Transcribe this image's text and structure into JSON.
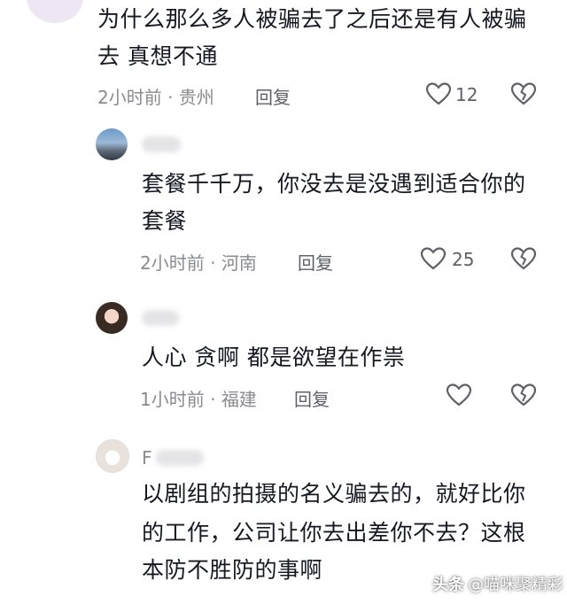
{
  "comments": [
    {
      "text_lines": [
        "为什么那么多人被骗去了之后还是有人被骗",
        "去 真想不通"
      ],
      "time": "2小时前",
      "location": "贵州",
      "reply_label": "回复",
      "likes": "12"
    },
    {
      "text_lines": [
        "套餐千千万，你没去是没遇到适合你的",
        "套餐"
      ],
      "time": "2小时前",
      "location": "河南",
      "reply_label": "回复",
      "likes": "25"
    },
    {
      "text_lines": [
        "人心 贪啊 都是欲望在作祟"
      ],
      "time": "1小时前",
      "location": "福建",
      "reply_label": "回复",
      "likes": ""
    },
    {
      "username_initial": "F",
      "text_lines": [
        "以剧组的拍摄的名义骗去的，就好比你",
        "的工作，公司让你去出差你不去？这根",
        "本防不胜防的事啊"
      ]
    }
  ],
  "separator": " · ",
  "watermark": {
    "platform": "头条",
    "account": "@喵咪聚精彩"
  },
  "colors": {
    "text": "#161823",
    "meta": "#8a8b91",
    "icon": "#5f6067"
  },
  "icons": {
    "like": "heart-outline-icon",
    "dislike": "broken-heart-icon"
  }
}
